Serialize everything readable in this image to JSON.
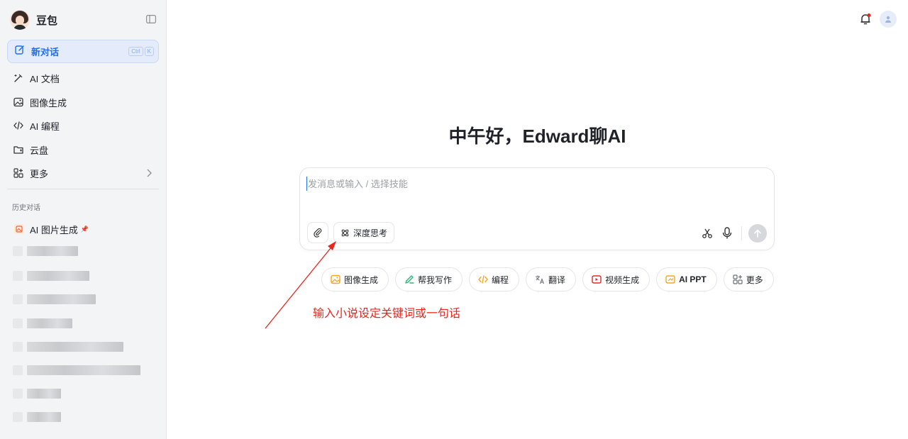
{
  "app": {
    "name": "豆包"
  },
  "sidebar": {
    "new_chat": {
      "label": "新对话",
      "shortcut": [
        "Ctrl",
        "K"
      ]
    },
    "items": [
      {
        "label": "AI 文档",
        "icon": "pen-sparkle-icon"
      },
      {
        "label": "图像生成",
        "icon": "image-icon"
      },
      {
        "label": "AI 编程",
        "icon": "code-icon"
      },
      {
        "label": "云盘",
        "icon": "cloud-drive-icon"
      },
      {
        "label": "更多",
        "icon": "apps-grid-icon"
      }
    ],
    "history_title": "历史对话",
    "pinned_history": {
      "label": "AI 图片生成",
      "pinned": true
    }
  },
  "main": {
    "greeting": "中午好，Edward聊AI",
    "composer": {
      "placeholder": "发消息或输入 / 选择技能",
      "value": "",
      "deep_think_label": "深度思考"
    },
    "skills": [
      {
        "label": "图像生成",
        "icon": "image-icon",
        "color": "#f5a623"
      },
      {
        "label": "帮我写作",
        "icon": "pen-icon",
        "color": "#2bb673"
      },
      {
        "label": "编程",
        "icon": "code-icon",
        "color": "#f5a623"
      },
      {
        "label": "翻译",
        "icon": "translate-icon",
        "color": "#6b7078"
      },
      {
        "label": "视频生成",
        "icon": "video-icon",
        "color": "#e8261f"
      },
      {
        "label": "AI PPT",
        "icon": "ppt-icon",
        "color": "#f5a623"
      },
      {
        "label": "更多",
        "icon": "apps-grid-icon",
        "color": "#6b7078"
      }
    ]
  },
  "annotation": {
    "text": "输入小说设定关键词或一句话",
    "color": "#e8261f"
  },
  "colors": {
    "accent": "#1f6ef0",
    "notification_dot": "#e8261f"
  }
}
